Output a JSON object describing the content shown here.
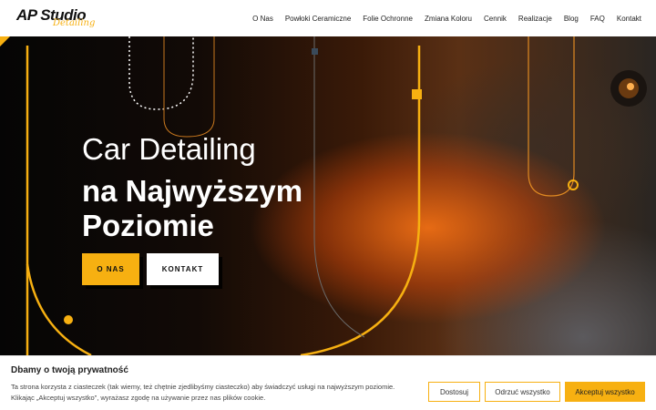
{
  "header": {
    "logo": {
      "main": "AP Studio",
      "sub": "Detailing"
    },
    "nav": [
      {
        "label": "O Nas"
      },
      {
        "label": "Powłoki Ceramiczne"
      },
      {
        "label": "Folie Ochronne"
      },
      {
        "label": "Zmiana Koloru"
      },
      {
        "label": "Cennik"
      },
      {
        "label": "Realizacje"
      },
      {
        "label": "Blog"
      },
      {
        "label": "FAQ"
      },
      {
        "label": "Kontakt"
      }
    ]
  },
  "hero": {
    "title_light": "Car Detailing",
    "title_bold": "na Najwyższym Poziomie",
    "buttons": {
      "primary": "O NAS",
      "secondary": "KONTAKT"
    }
  },
  "cookie": {
    "title": "Dbamy o twoją prywatność",
    "text": "Ta strona korzysta z ciasteczek (tak wiemy, też chętnie zjedlibyśmy ciasteczko) aby świadczyć usługi na najwyższym poziomie. Klikając „Akceptuj wszystko”, wyrażasz zgodę na używanie przez nas plików cookie.",
    "buttons": {
      "customize": "Dostosuj",
      "reject": "Odrzuć wszystko",
      "accept": "Akceptuj wszystko"
    }
  },
  "colors": {
    "accent": "#f7b011"
  }
}
